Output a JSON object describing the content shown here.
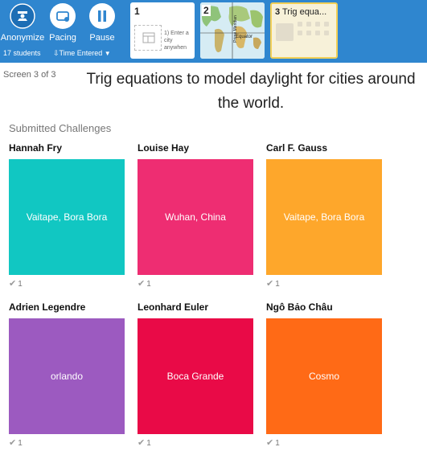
{
  "toolbar": {
    "anonymize_label": "Anonymize",
    "pacing_label": "Pacing",
    "pause_label": "Pause",
    "student_count": "17 students",
    "sort_label": "Time Entered"
  },
  "screens": [
    {
      "number": "1",
      "caption": "1) Enter a city anywhen"
    },
    {
      "number": "2",
      "map_label": "Equator",
      "side_label": "Prime Meridian"
    },
    {
      "number": "3",
      "title": "Trig equa..."
    }
  ],
  "page": {
    "screen_label": "Screen 3 of 3",
    "title": "Trig equations to model daylight for cities around the world."
  },
  "submissions": {
    "section_title": "Submitted Challenges",
    "cards": [
      {
        "student": "Hannah Fry",
        "text": "Vaitape, Bora Bora",
        "color": "#11c7c2",
        "votes": "1"
      },
      {
        "student": "Louise Hay",
        "text": "Wuhan, China",
        "color": "#ee2d72",
        "votes": "1"
      },
      {
        "student": "Carl F. Gauss",
        "text": "Vaitape, Bora Bora",
        "color": "#fea72b",
        "votes": "1"
      },
      {
        "student": "Adrien Legendre",
        "text": "orlando",
        "color": "#9c5ac0",
        "votes": "1"
      },
      {
        "student": "Leonhard Euler",
        "text": "Boca Grande",
        "color": "#e90a47",
        "votes": "1"
      },
      {
        "student": "Ngô Bảo Châu",
        "text": "Cosmo",
        "color": "#ff6a16",
        "votes": "1"
      }
    ]
  }
}
